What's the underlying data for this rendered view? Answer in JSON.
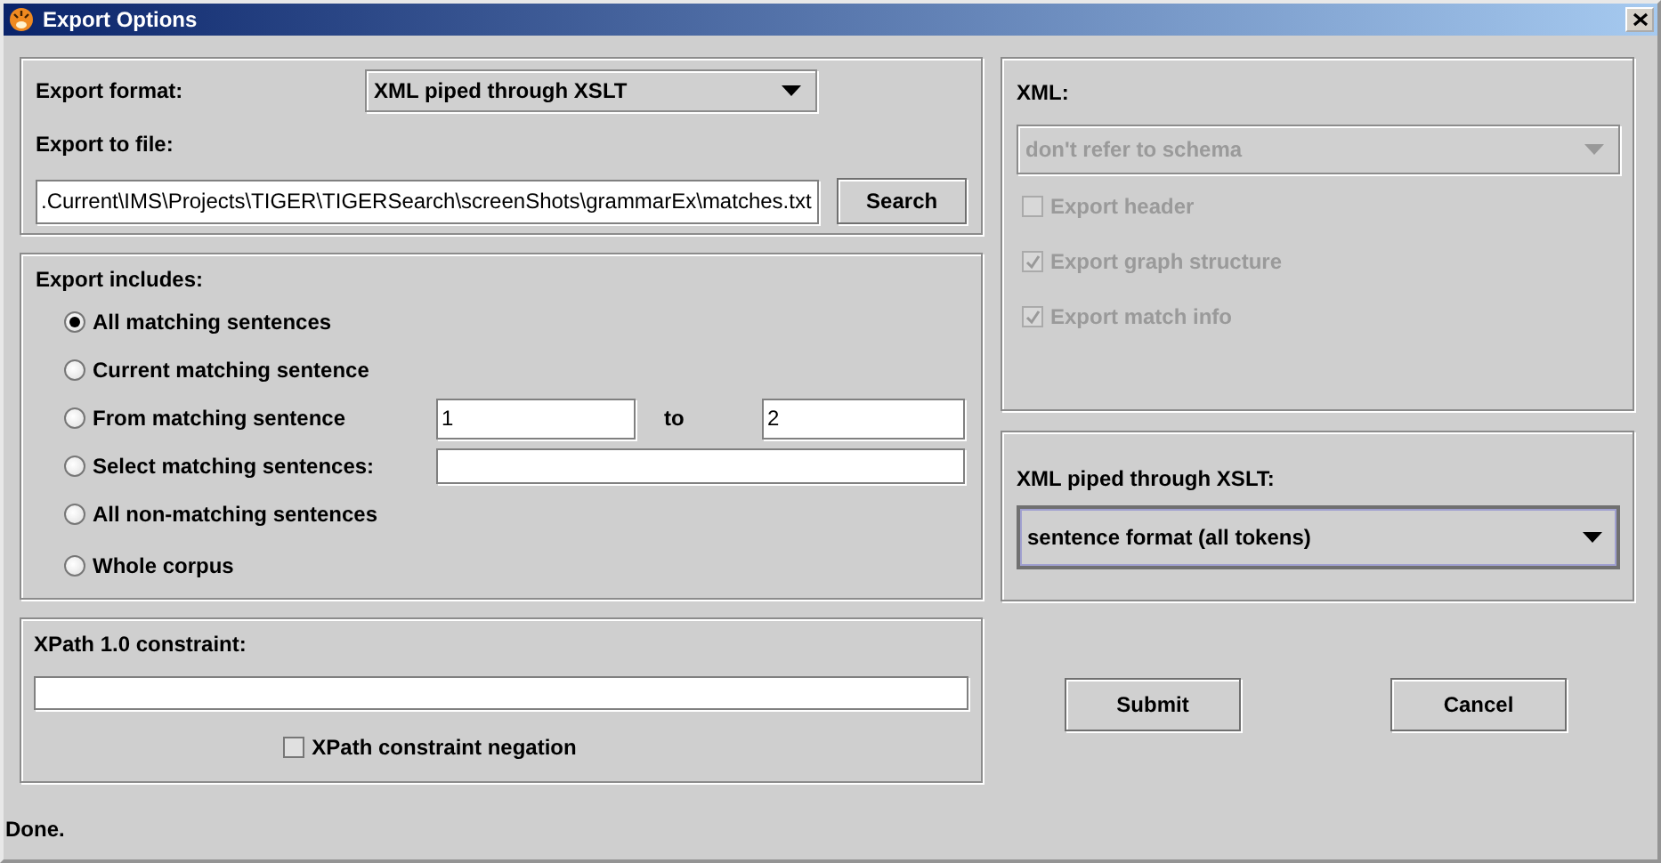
{
  "window": {
    "title": "Export Options"
  },
  "export": {
    "format_label": "Export format:",
    "format": {
      "value": "XML piped through XSLT"
    },
    "file_label": "Export to file:",
    "file": {
      "value": ".Current\\IMS\\Projects\\TIGER\\TIGERSearch\\screenShots\\grammarEx\\matches.txt"
    },
    "search_button": "Search"
  },
  "includes": {
    "title": "Export includes:",
    "options": [
      {
        "kind": "plain",
        "label": "All matching sentences",
        "selected": true
      },
      {
        "kind": "plain",
        "label": "Current matching sentence",
        "selected": false
      },
      {
        "kind": "range",
        "label": "From matching sentence",
        "selected": false,
        "from": "1",
        "to_label": "to",
        "to": "2"
      },
      {
        "kind": "field",
        "label": "Select matching sentences:",
        "selected": false
      },
      {
        "kind": "plain",
        "label": "All non-matching sentences",
        "selected": false
      },
      {
        "kind": "plain",
        "label": "Whole corpus",
        "selected": false
      }
    ]
  },
  "xpath": {
    "title": "XPath 1.0 constraint:",
    "negation": {
      "label": "XPath constraint negation",
      "checked": false
    }
  },
  "xml": {
    "title": "XML:",
    "schema": {
      "value": "don't refer to schema",
      "disabled": true
    },
    "options": [
      {
        "label": "Export header",
        "checked": false,
        "disabled": true
      },
      {
        "label": "Export graph structure",
        "checked": true,
        "disabled": true
      },
      {
        "label": "Export match info",
        "checked": true,
        "disabled": true
      }
    ]
  },
  "xslt": {
    "title": "XML piped through XSLT:",
    "stylesheet": {
      "value": "sentence format (all tokens)",
      "focused": true
    }
  },
  "buttons": [
    "Submit",
    "Cancel"
  ],
  "status_bar": "Done."
}
